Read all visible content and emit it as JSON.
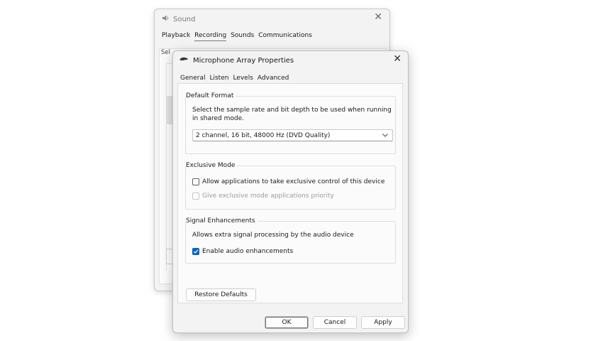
{
  "background_window": {
    "title": "Sound",
    "tabs": [
      "Playback",
      "Recording",
      "Sounds",
      "Communications"
    ],
    "active_tab": 1,
    "instruction_fragment": "Sel"
  },
  "dialog": {
    "title": "Microphone Array Properties",
    "tabs": [
      "General",
      "Listen",
      "Levels",
      "Advanced"
    ],
    "active_tab": 3,
    "default_format": {
      "legend": "Default Format",
      "description": "Select the sample rate and bit depth to be used when running in shared mode.",
      "selected": "2 channel, 16 bit, 48000 Hz (DVD Quality)"
    },
    "exclusive_mode": {
      "legend": "Exclusive Mode",
      "allow_label": "Allow applications to take exclusive control of this device",
      "allow_checked": false,
      "priority_label": "Give exclusive mode applications priority",
      "priority_checked": false
    },
    "signal_enhancements": {
      "legend": "Signal Enhancements",
      "description": "Allows extra signal processing by the audio device",
      "enable_label": "Enable audio enhancements",
      "enable_checked": true
    },
    "buttons": {
      "restore": "Restore Defaults",
      "ok": "OK",
      "cancel": "Cancel",
      "apply": "Apply"
    }
  },
  "colors": {
    "accent": "#0067c0"
  },
  "icons": {
    "close": "close-icon",
    "speaker": "speaker-icon",
    "microphone": "microphone-icon",
    "chevron": "chevron-down-icon",
    "check": "checkmark-icon"
  }
}
